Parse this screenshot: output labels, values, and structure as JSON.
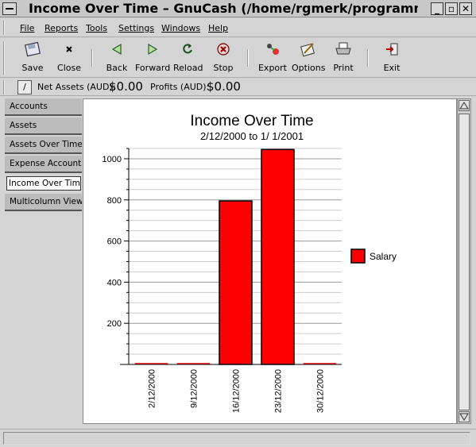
{
  "window": {
    "title": "Income Over Time – GnuCash (/home/rgmerk/programming/gn",
    "buttons": {
      "minimize": "_",
      "maximize": "▫",
      "close": "✕"
    }
  },
  "menubar": {
    "items": [
      {
        "label": "File"
      },
      {
        "label": "Reports"
      },
      {
        "label": "Tools"
      },
      {
        "label": "Settings"
      },
      {
        "label": "Windows"
      },
      {
        "label": "Help"
      }
    ]
  },
  "toolbar": {
    "buttons": [
      {
        "label": "Save",
        "icon": "floppy-disk-icon"
      },
      {
        "label": "Close",
        "icon": "close-x-icon"
      },
      {
        "label": "Back",
        "icon": "arrow-left-icon"
      },
      {
        "label": "Forward",
        "icon": "arrow-right-icon"
      },
      {
        "label": "Reload",
        "icon": "reload-icon"
      },
      {
        "label": "Stop",
        "icon": "stop-icon"
      },
      {
        "label": "Export",
        "icon": "export-icon"
      },
      {
        "label": "Options",
        "icon": "options-icon"
      },
      {
        "label": "Print",
        "icon": "printer-icon"
      },
      {
        "label": "Exit",
        "icon": "exit-door-icon"
      }
    ]
  },
  "summary": {
    "combo_glyph": "/",
    "net_assets_label": "Net Assets (AUD):",
    "net_assets_value": "$0.00",
    "profits_label": "Profits (AUD):",
    "profits_value": "$0.00"
  },
  "tabs": [
    {
      "label": "Accounts",
      "active": false
    },
    {
      "label": "Assets",
      "active": false
    },
    {
      "label": "Assets Over Time",
      "active": false
    },
    {
      "label": "Expense Accounts",
      "active": false
    },
    {
      "label": "Income Over Time",
      "active": true
    },
    {
      "label": "Multicolumn View",
      "active": false
    }
  ],
  "colors": {
    "bar_fill": "#ff0000",
    "bar_stroke": "#000000"
  },
  "chart_data": {
    "type": "bar",
    "title": "Income Over Time",
    "subtitle": "2/12/2000 to 1/ 1/2001",
    "categories": [
      "2/12/2000",
      "9/12/2000",
      "16/12/2000",
      "23/12/2000",
      "30/12/2000"
    ],
    "series": [
      {
        "name": "Salary",
        "values": [
          0,
          0,
          795,
          1045,
          0
        ]
      }
    ],
    "ylim": [
      0,
      1050
    ],
    "yticks": [
      200,
      400,
      600,
      800,
      1000
    ],
    "grid": true,
    "legend": "right"
  }
}
